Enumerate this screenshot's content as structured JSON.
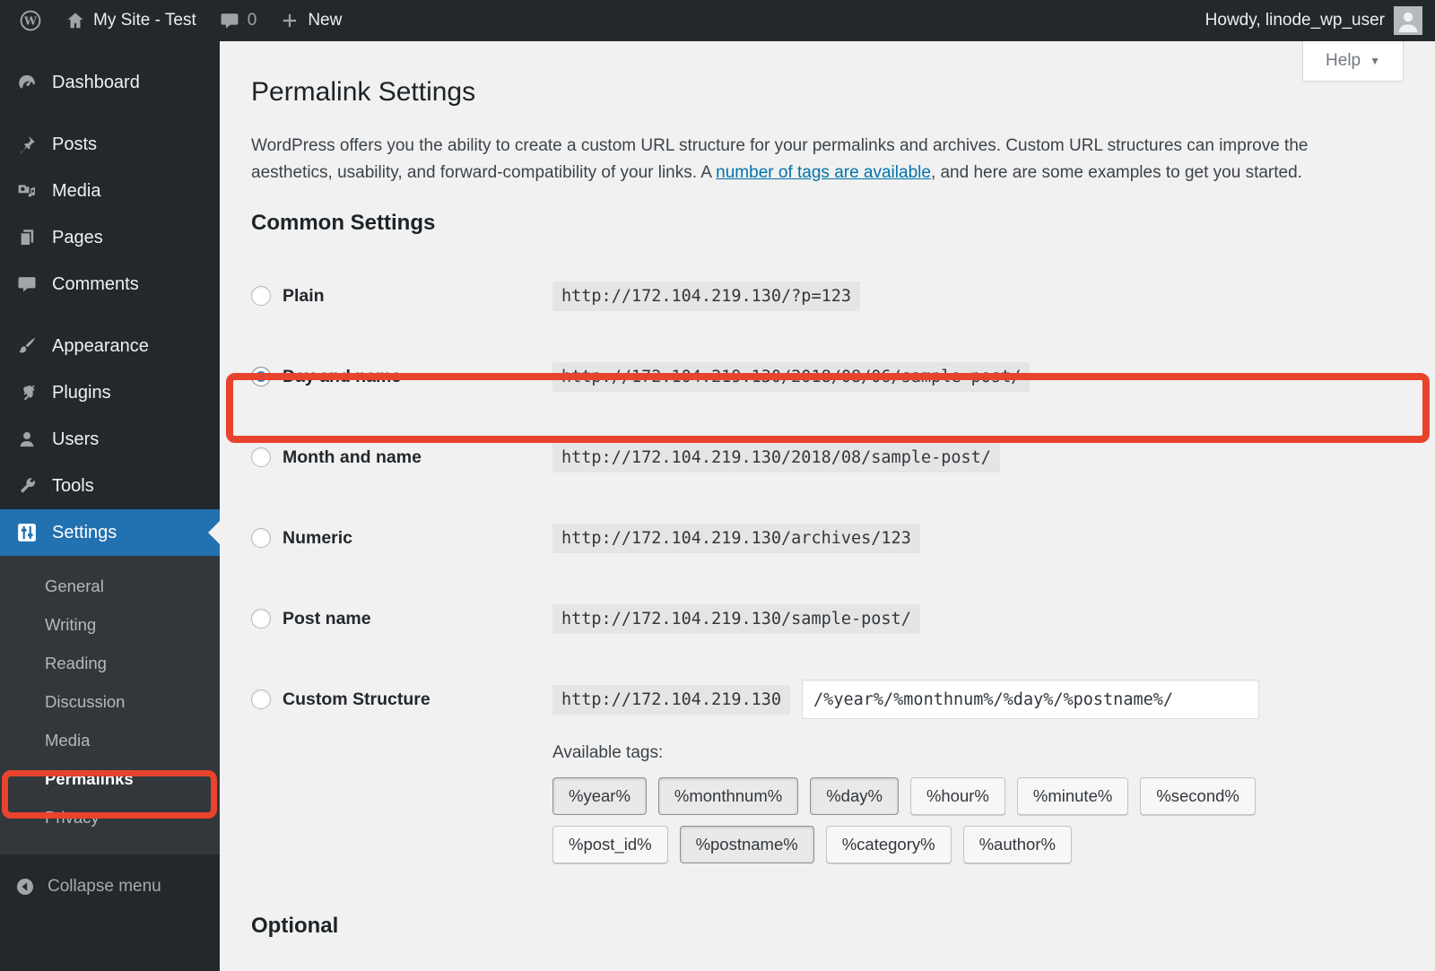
{
  "admin_bar": {
    "site_name": "My Site - Test",
    "comment_count": "0",
    "new_label": "New",
    "howdy": "Howdy, linode_wp_user"
  },
  "sidebar": {
    "items": [
      {
        "label": "Dashboard",
        "icon": "dashboard-icon"
      },
      {
        "label": "Posts",
        "icon": "pushpin-icon"
      },
      {
        "label": "Media",
        "icon": "media-icon"
      },
      {
        "label": "Pages",
        "icon": "pages-icon"
      },
      {
        "label": "Comments",
        "icon": "comments-icon"
      },
      {
        "label": "Appearance",
        "icon": "brush-icon"
      },
      {
        "label": "Plugins",
        "icon": "plug-icon"
      },
      {
        "label": "Users",
        "icon": "user-icon"
      },
      {
        "label": "Tools",
        "icon": "wrench-icon"
      },
      {
        "label": "Settings",
        "icon": "settings-icon"
      }
    ],
    "submenu": [
      "General",
      "Writing",
      "Reading",
      "Discussion",
      "Media",
      "Permalinks",
      "Privacy"
    ],
    "collapse_label": "Collapse menu"
  },
  "main": {
    "help_label": "Help",
    "title": "Permalink Settings",
    "intro": {
      "before_link": "WordPress offers you the ability to create a custom URL structure for your permalinks and archives. Custom URL structures can improve the aesthetics, usability, and forward-compatibility of your links. A ",
      "link_text": "number of tags are available",
      "after_link": ", and here are some examples to get you started."
    },
    "common_settings_heading": "Common Settings",
    "options": [
      {
        "label": "Plain",
        "example": "http://172.104.219.130/?p=123",
        "selected": false
      },
      {
        "label": "Day and name",
        "example": "http://172.104.219.130/2018/08/06/sample-post/",
        "selected": true
      },
      {
        "label": "Month and name",
        "example": "http://172.104.219.130/2018/08/sample-post/",
        "selected": false
      },
      {
        "label": "Numeric",
        "example": "http://172.104.219.130/archives/123",
        "selected": false
      },
      {
        "label": "Post name",
        "example": "http://172.104.219.130/sample-post/",
        "selected": false
      },
      {
        "label": "Custom Structure",
        "base": "http://172.104.219.130",
        "input_value": "/%year%/%monthnum%/%day%/%postname%/",
        "selected": false
      }
    ],
    "available_tags_label": "Available tags:",
    "tags": [
      {
        "label": "%year%",
        "active": true
      },
      {
        "label": "%monthnum%",
        "active": true
      },
      {
        "label": "%day%",
        "active": true
      },
      {
        "label": "%hour%",
        "active": false
      },
      {
        "label": "%minute%",
        "active": false
      },
      {
        "label": "%second%",
        "active": false
      },
      {
        "label": "%post_id%",
        "active": false
      },
      {
        "label": "%postname%",
        "active": true
      },
      {
        "label": "%category%",
        "active": false
      },
      {
        "label": "%author%",
        "active": false
      }
    ],
    "optional_heading": "Optional"
  },
  "colors": {
    "admin_bar_bg": "#23282d",
    "submenu_bg": "#32373c",
    "active_menu_blue": "#2271b1",
    "content_bg": "#f1f1f1",
    "link_blue": "#0073aa",
    "radio_dot_blue": "#3582c4",
    "annotation_red": "#e8432d"
  }
}
